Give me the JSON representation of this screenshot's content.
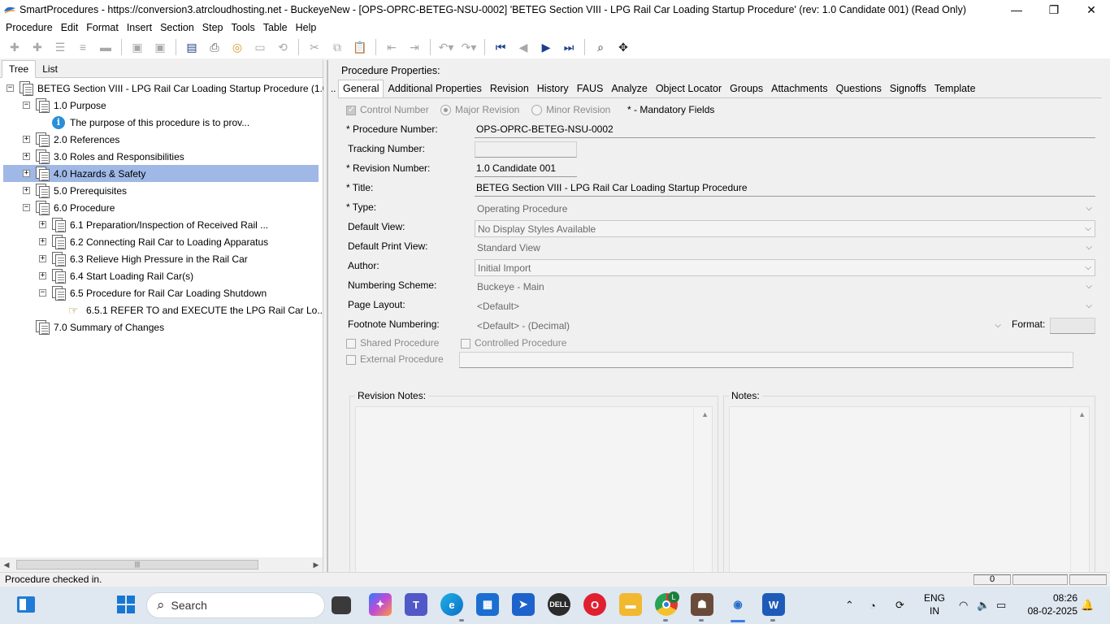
{
  "window": {
    "title": "SmartProcedures - https://conversion3.atrcloudhosting.net - BuckeyeNew - [OPS-OPRC-BETEG-NSU-0002] 'BETEG Section VIII - LPG Rail Car Loading Startup Procedure' (rev: 1.0 Candidate 001) (Read Only)",
    "minimize": "—",
    "restore": "❐",
    "close": "✕"
  },
  "menu": [
    "Procedure",
    "Edit",
    "Format",
    "Insert",
    "Section",
    "Step",
    "Tools",
    "Table",
    "Help"
  ],
  "left": {
    "tabs": [
      "Tree",
      "List"
    ],
    "tree": [
      {
        "level": 0,
        "exp": "−",
        "icon": "doc",
        "label": "BETEG Section VIII - LPG Rail Car Loading Startup Procedure (1.0..."
      },
      {
        "level": 1,
        "exp": "−",
        "icon": "doc",
        "label": "1.0 Purpose"
      },
      {
        "level": 2,
        "exp": "",
        "icon": "info",
        "label": "The purpose of this procedure is to prov..."
      },
      {
        "level": 1,
        "exp": "+",
        "icon": "doc",
        "label": "2.0 References"
      },
      {
        "level": 1,
        "exp": "+",
        "icon": "doc",
        "label": "3.0 Roles and Responsibilities"
      },
      {
        "level": 1,
        "exp": "+",
        "icon": "doc",
        "label": "4.0 Hazards & Safety",
        "selected": true
      },
      {
        "level": 1,
        "exp": "+",
        "icon": "doc",
        "label": "5.0 Prerequisites"
      },
      {
        "level": 1,
        "exp": "−",
        "icon": "doc",
        "label": "6.0 Procedure"
      },
      {
        "level": 2,
        "exp": "+",
        "icon": "doc",
        "label": "6.1 Preparation/Inspection of Received Rail ..."
      },
      {
        "level": 2,
        "exp": "+",
        "icon": "doc",
        "label": "6.2 Connecting Rail Car to Loading Apparatus"
      },
      {
        "level": 2,
        "exp": "+",
        "icon": "doc",
        "label": "6.3 Relieve High Pressure in the Rail Car"
      },
      {
        "level": 2,
        "exp": "+",
        "icon": "doc",
        "label": "6.4 Start Loading Rail Car(s)"
      },
      {
        "level": 2,
        "exp": "−",
        "icon": "doc",
        "label": "6.5 Procedure for Rail Car Loading Shutdown"
      },
      {
        "level": 3,
        "exp": "",
        "icon": "step",
        "label": "6.5.1 REFER TO and EXECUTE the LPG Rail Car Lo..."
      },
      {
        "level": 1,
        "exp": "",
        "icon": "doc",
        "label": "7.0 Summary of Changes"
      }
    ]
  },
  "right": {
    "title": "Procedure Properties:",
    "tabs": [
      "General",
      "Additional Properties",
      "Revision",
      "History",
      "FAUS",
      "Analyze",
      "Object Locator",
      "Groups",
      "Attachments",
      "Questions",
      "Signoffs",
      "Template"
    ],
    "control_number": "Control Number",
    "major_revision": "Major Revision",
    "minor_revision": "Minor Revision",
    "mandatory": "* - Mandatory Fields",
    "labels": {
      "procedure_number": "* Procedure Number:",
      "tracking_number": "Tracking Number:",
      "revision_number": "* Revision Number:",
      "title": "* Title:",
      "type": "* Type:",
      "default_view": "Default View:",
      "default_print_view": "Default Print View:",
      "author": "Author:",
      "numbering_scheme": "Numbering Scheme:",
      "page_layout": "Page Layout:",
      "footnote_numbering": "Footnote Numbering:",
      "format": "Format:"
    },
    "values": {
      "procedure_number": "OPS-OPRC-BETEG-NSU-0002",
      "tracking_number": "",
      "revision_number": "1.0 Candidate 001",
      "title": "BETEG Section VIII - LPG Rail Car Loading Startup Procedure",
      "type": "Operating Procedure",
      "default_view": "No Display Styles Available",
      "default_print_view": "Standard View",
      "author": "Initial Import",
      "numbering_scheme": "Buckeye - Main",
      "page_layout": "<Default>",
      "footnote_numbering": "<Default> - (Decimal)",
      "format": ""
    },
    "shared_procedure": "Shared Procedure",
    "controlled_procedure": "Controlled Procedure",
    "external_procedure": "External Procedure",
    "revision_notes": "Revision Notes:",
    "notes": "Notes:"
  },
  "status": {
    "text": "Procedure checked in.",
    "cell1": "0",
    "cell2": "",
    "cell3": ""
  },
  "taskbar": {
    "search": "Search",
    "lang1": "ENG",
    "lang2": "IN",
    "time": "08:26",
    "date": "08-02-2025",
    "chrome_badge": "L"
  }
}
